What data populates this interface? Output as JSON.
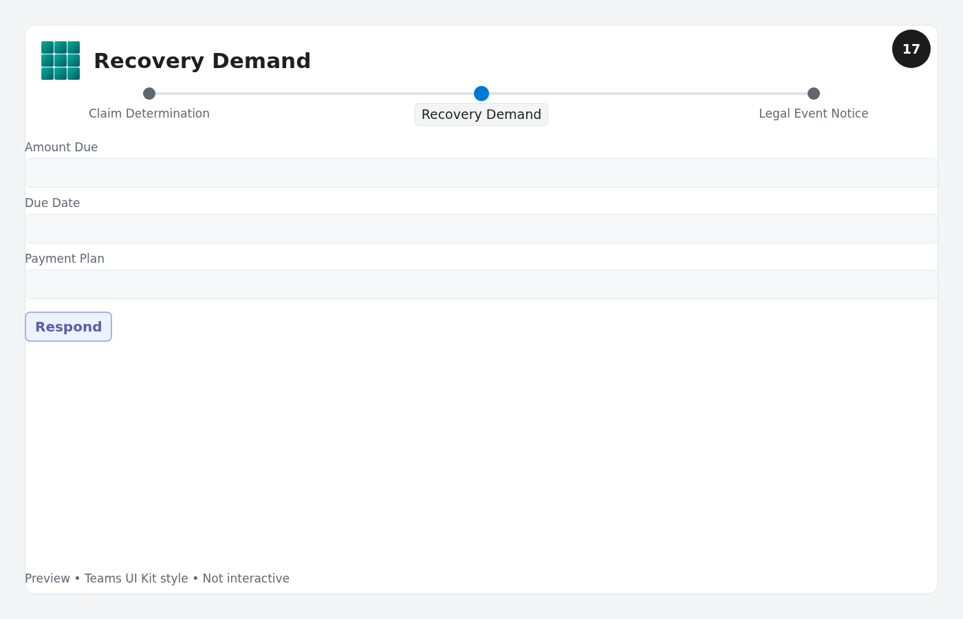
{
  "header": {
    "title": "Recovery Demand",
    "badge": "17"
  },
  "steps": [
    {
      "label": "Claim Determination",
      "selected": false
    },
    {
      "label": "Recovery Demand",
      "selected": true
    },
    {
      "label": "Legal Event Notice",
      "selected": false
    }
  ],
  "fields": [
    {
      "label": "Amount Due"
    },
    {
      "label": "Due Date"
    },
    {
      "label": "Payment Plan"
    }
  ],
  "button": "Respond",
  "footer": "Preview • Teams UI Kit style • Not interactive"
}
